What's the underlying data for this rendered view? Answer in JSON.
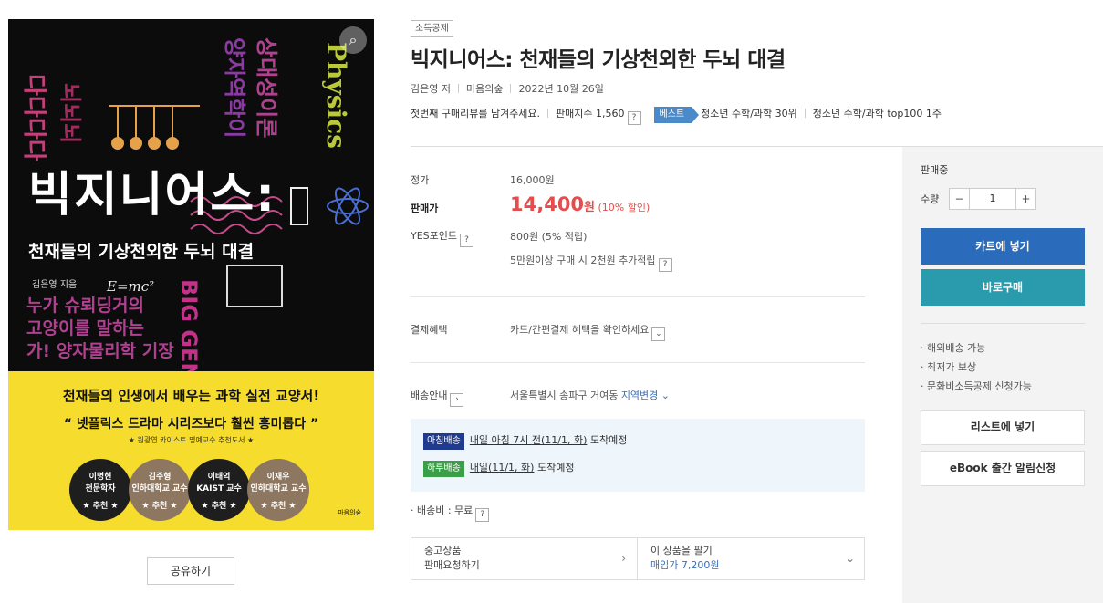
{
  "cover": {
    "zoom_icon": "zoom-icon",
    "title_main": "빅지니어스:",
    "subtitle": "천재들의 기상천외한 두뇌 대결",
    "author": "김은영 지음",
    "formula": "E=mc²",
    "banner": "천재들의 인생에서 배우는 과학 실전 교양서!",
    "quote": "“ 넷플릭스 드라마 시리즈보다 훨씬 흥미롭다 ”",
    "quote_source": "★ 원광연 카이스트 명예교수 추천도서 ★",
    "badges": [
      {
        "name": "이명현",
        "desc": "천문학자",
        "rec": "★ 추천 ★",
        "color": "#1e1e1e"
      },
      {
        "name": "김주형",
        "desc": "인하대학교 교수",
        "rec": "★ 추천 ★",
        "color": "#8d7760"
      },
      {
        "name": "이태억",
        "desc": "KAIST 교수",
        "rec": "★ 추천 ★",
        "color": "#1e1e1e"
      },
      {
        "name": "이재우",
        "desc": "인하대학교 교수",
        "rec": "★ 추천 ★",
        "color": "#8d7760"
      }
    ],
    "publisher_logo": "마음의숲"
  },
  "share_button": "공유하기",
  "product": {
    "tag": "소득공제",
    "title": "빅지니어스: 천재들의 기상천외한 두뇌 대결",
    "author": "김은영 저",
    "publisher": "마음의숲",
    "date": "2022년 10월 26일",
    "review_prompt": "첫번째 구매리뷰를 남겨주세요.",
    "sales_index": "판매지수 1,560",
    "best_badge": "베스트",
    "rank1": "청소년 수학/과학 30위",
    "rank2": "청소년 수학/과학 top100 1주"
  },
  "price": {
    "list_label": "정가",
    "list_value": "16,000원",
    "sale_label": "판매가",
    "sale_value": "14,400",
    "sale_unit": "원",
    "discount": "(10% 할인)",
    "points_label": "YES포인트",
    "points_value": "800원 (5% 적립)",
    "points_extra": "5만원이상 구매 시 2천원 추가적립"
  },
  "payment": {
    "label": "결제혜택",
    "value": "카드/간편결제 혜택을 확인하세요"
  },
  "delivery": {
    "label": "배송안내",
    "address": "서울특별시 송파구 거여동",
    "change_link": "지역변경",
    "morning_badge": "아침배송",
    "morning_text_u": "내일 아침 7시 전(11/1, 화)",
    "morning_text": "도착예정",
    "day_badge": "하루배송",
    "day_text_u": "내일(11/1, 화)",
    "day_text": "도착예정",
    "fee": "· 배송비 : 무료"
  },
  "used": {
    "left_line1": "중고상품",
    "left_line2": "판매요청하기",
    "right_line1": "이 상품을 팔기",
    "right_line2": "매입가 7,200원"
  },
  "panel": {
    "state": "판매중",
    "qty_label": "수량",
    "qty_value": "1",
    "cart": "카트에 넣기",
    "buy": "바로구매",
    "bullets": [
      "· 해외배송 가능",
      "· 최저가 보상",
      "· 문화비소득공제 신청가능"
    ],
    "list_btn": "리스트에 넣기",
    "ebook_btn": "eBook 출간 알림신청"
  },
  "colors": {
    "accent_blue": "#2a6bbc",
    "accent_teal": "#2a9aad",
    "price_red": "#e64c4c",
    "best_blue": "#4a8ac9",
    "morning_badge": "#1f3a8f",
    "day_badge": "#3aa047"
  }
}
